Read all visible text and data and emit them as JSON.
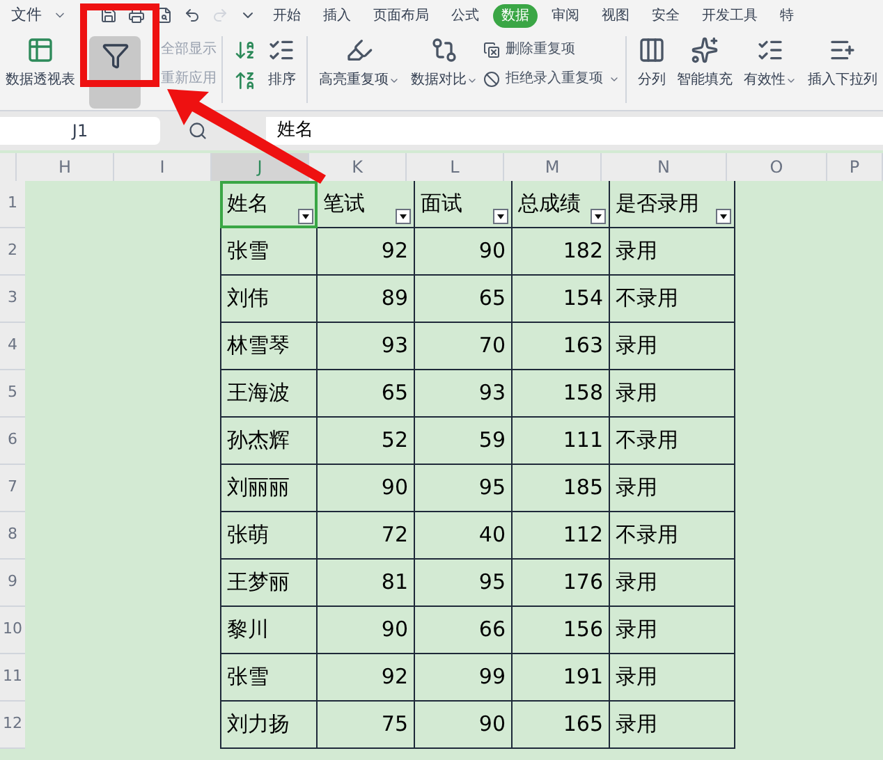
{
  "menu": {
    "file": "文件",
    "tabs": [
      {
        "label": "开始",
        "selected": false
      },
      {
        "label": "插入",
        "selected": false
      },
      {
        "label": "页面布局",
        "selected": false
      },
      {
        "label": "公式",
        "selected": false
      },
      {
        "label": "数据",
        "selected": true
      },
      {
        "label": "审阅",
        "selected": false
      },
      {
        "label": "视图",
        "selected": false
      },
      {
        "label": "安全",
        "selected": false
      },
      {
        "label": "开发工具",
        "selected": false
      },
      {
        "label": "特",
        "selected": false
      }
    ]
  },
  "ribbon": {
    "pivot": "数据透视表",
    "show_all": {
      "label": "全部显示",
      "disabled": true
    },
    "reapply": {
      "label": "重新应用",
      "disabled": true
    },
    "sort": "排序",
    "highlight": "高亮重复项",
    "compare": "数据对比",
    "remove_dup": "删除重复项",
    "reject_dup": "拒绝录入重复项",
    "split": "分列",
    "smart_fill": "智能填充",
    "validity": "有效性",
    "dropdown": "插入下拉列"
  },
  "formula_bar": {
    "name_box": "J1",
    "value": "姓名"
  },
  "column_headers": [
    {
      "label": "H",
      "selected": false
    },
    {
      "label": "I",
      "selected": false
    },
    {
      "label": "J",
      "selected": true
    },
    {
      "label": "K",
      "selected": false
    },
    {
      "label": "L",
      "selected": false
    },
    {
      "label": "M",
      "selected": false
    },
    {
      "label": "N",
      "selected": false
    },
    {
      "label": "O",
      "selected": false
    },
    {
      "label": "P",
      "selected": false
    }
  ],
  "sheet": {
    "header": [
      "姓名",
      "笔试",
      "面试",
      "总成绩",
      "是否录用"
    ],
    "rows": [
      {
        "n": "2",
        "cells": [
          "张雪",
          "92",
          "90",
          "182",
          "录用"
        ]
      },
      {
        "n": "3",
        "cells": [
          "刘伟",
          "89",
          "65",
          "154",
          "不录用"
        ]
      },
      {
        "n": "4",
        "cells": [
          "林雪琴",
          "93",
          "70",
          "163",
          "录用"
        ]
      },
      {
        "n": "5",
        "cells": [
          "王海波",
          "65",
          "93",
          "158",
          "录用"
        ]
      },
      {
        "n": "6",
        "cells": [
          "孙杰辉",
          "52",
          "59",
          "111",
          "不录用"
        ]
      },
      {
        "n": "7",
        "cells": [
          "刘丽丽",
          "90",
          "95",
          "185",
          "录用"
        ]
      },
      {
        "n": "8",
        "cells": [
          "张萌",
          "72",
          "40",
          "112",
          "不录用"
        ]
      },
      {
        "n": "9",
        "cells": [
          "王梦丽",
          "81",
          "95",
          "176",
          "录用"
        ]
      },
      {
        "n": "10",
        "cells": [
          "黎川",
          "90",
          "66",
          "156",
          "录用"
        ]
      },
      {
        "n": "11",
        "cells": [
          "张雪",
          "92",
          "99",
          "191",
          "录用"
        ]
      },
      {
        "n": "12",
        "cells": [
          "刘力扬",
          "75",
          "90",
          "165",
          "录用"
        ]
      }
    ],
    "header_row": "1"
  }
}
